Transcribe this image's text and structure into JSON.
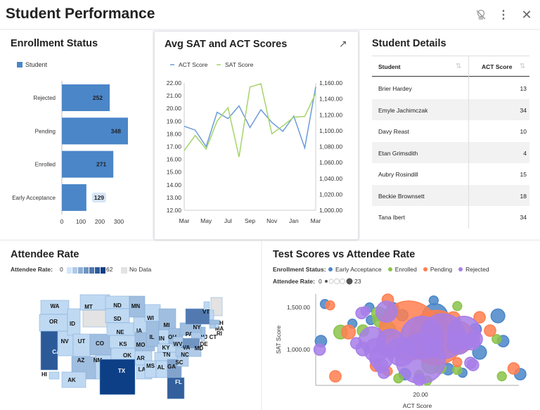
{
  "header": {
    "title": "Student Performance",
    "icons": [
      "no-filter-icon",
      "more-vert-icon",
      "close-icon"
    ]
  },
  "enrollment": {
    "title": "Enrollment Status",
    "legend": "Student",
    "color": "#4a86c8",
    "chart_data": {
      "type": "bar",
      "orientation": "horizontal",
      "categories": [
        "Rejected",
        "Pending",
        "Enrolled",
        "Early Acceptance"
      ],
      "series": [
        {
          "name": "Student",
          "values": [
            252,
            348,
            271,
            129
          ]
        }
      ],
      "xticks": [
        "0",
        "100",
        "200",
        "300"
      ],
      "xlim": [
        0,
        350
      ]
    }
  },
  "sat_act": {
    "title": "Avg SAT and ACT Scores",
    "expand_icon": "expand-arrow-icon",
    "chart_data": {
      "type": "line",
      "x": [
        "Mar",
        "Apr",
        "May",
        "Jun",
        "Jul",
        "Aug",
        "Sep",
        "Oct",
        "Nov",
        "Dec",
        "Jan",
        "Feb",
        "Mar"
      ],
      "xticks": [
        "Mar",
        "May",
        "Jul",
        "Sep",
        "Nov",
        "Jan",
        "Mar"
      ],
      "series": [
        {
          "name": "ACT Score",
          "axis": "left",
          "color": "#6b9bd8",
          "values": [
            18.6,
            18.3,
            17.0,
            19.7,
            19.2,
            20.2,
            18.5,
            19.9,
            18.9,
            18.2,
            19.4,
            16.9,
            21.7
          ]
        },
        {
          "name": "SAT Score",
          "axis": "right",
          "color": "#a6d46b",
          "values": [
            1075,
            1094,
            1077,
            1112,
            1129,
            1067,
            1155,
            1159,
            1096,
            1106,
            1117,
            1118,
            1147
          ]
        }
      ],
      "ylim_left": [
        12,
        22
      ],
      "yticks_left": [
        "22.00",
        "21.00",
        "20.00",
        "19.00",
        "18.00",
        "17.00",
        "16.00",
        "15.00",
        "14.00",
        "13.00",
        "12.00"
      ],
      "ylim_right": [
        1000,
        1160
      ],
      "yticks_right": [
        "1,160.00",
        "1,140.00",
        "1,120.00",
        "1,100.00",
        "1,080.00",
        "1,060.00",
        "1,040.00",
        "1,020.00",
        "1,000.00"
      ],
      "legend": "top-left"
    }
  },
  "details": {
    "title": "Student Details",
    "columns": [
      "Student",
      "ACT Score"
    ],
    "rows": [
      [
        "Brier Hardey",
        "13"
      ],
      [
        "Emyle Jachimczak",
        "34"
      ],
      [
        "Davy Reast",
        "10"
      ],
      [
        "Etan Grimsdith",
        "4"
      ],
      [
        "Aubry Rosindill",
        "15"
      ],
      [
        "Beckie Brownsett",
        "18"
      ],
      [
        "Tana Ibert",
        "34"
      ]
    ]
  },
  "attendee": {
    "title": "Attendee Rate",
    "legend_label": "Attendee Rate:",
    "min": "0",
    "max": "62",
    "nodata": "No Data",
    "color_low": "#cfe6fb",
    "color_high": "#0d3f86",
    "nodata_color": "#e3e3e3",
    "states": {
      "WA": 5,
      "OR": 5,
      "CA": 52,
      "NV": 5,
      "ID": 5,
      "MT": 5,
      "WY": null,
      "UT": 5,
      "CO": 15,
      "AZ": 15,
      "NM": 5,
      "ND": 5,
      "SD": 5,
      "NE": 5,
      "KS": 5,
      "OK": 5,
      "TX": 62,
      "MN": 15,
      "IA": 5,
      "MO": 15,
      "AR": 5,
      "LA": 5,
      "WI": 5,
      "IL": 15,
      "MS": 5,
      "MI": 15,
      "IN": 5,
      "OH": 15,
      "KY": 5,
      "TN": 5,
      "AL": 5,
      "GA": 25,
      "FL": 50,
      "SC": 8,
      "NC": 10,
      "VA": 30,
      "WV": 10,
      "PA": 15,
      "NY": 40,
      "VT": 5,
      "ME": null,
      "NH": 5,
      "MA": 15,
      "RI": 5,
      "CT": 10,
      "NJ": 15,
      "DE": 5,
      "MD": 10,
      "AK": 5,
      "HI": 5
    }
  },
  "scatter": {
    "title": "Test Scores vs Attendee Rate",
    "status_label": "Enrollment Status:",
    "rate_label": "Attendee Rate:",
    "rate_min": "0",
    "rate_max": "23",
    "chart_data": {
      "type": "scatter",
      "xlabel": "ACT Score",
      "ylabel": "SAT Score",
      "xticks": [
        "20.00"
      ],
      "yticks": [
        "1,500.00",
        "1,000.00"
      ],
      "xlim": [
        12,
        27.5
      ],
      "ylim": [
        575,
        1660
      ],
      "series": [
        {
          "name": "Early Acceptance",
          "color": "#4a86c8",
          "points": [
            [
              12.7,
              1541,
              2
            ],
            [
              12.4,
              1100,
              3
            ],
            [
              16.1,
              1500,
              2
            ],
            [
              16.2,
              1350,
              2
            ],
            [
              17.9,
              1490,
              3
            ],
            [
              18.6,
              1408,
              3
            ],
            [
              21.0,
              1583,
              2
            ],
            [
              21.1,
              1392,
              9
            ],
            [
              21.7,
              1292,
              4
            ],
            [
              22.3,
              1267,
              4
            ],
            [
              24.2,
              1242,
              3
            ],
            [
              25.9,
              1400,
              4
            ],
            [
              26.3,
              1100,
              3
            ],
            [
              24.5,
              967,
              4
            ],
            [
              22.1,
              767,
              3
            ],
            [
              23.2,
              725,
              2
            ],
            [
              18.8,
              708,
              3
            ],
            [
              27.6,
              708,
              3
            ],
            [
              20.7,
              1058,
              10
            ],
            [
              14.8,
              1308,
              2
            ]
          ]
        },
        {
          "name": "Enrolled",
          "color": "#8bc34a",
          "points": [
            [
              13.9,
              1208,
              4
            ],
            [
              15.6,
              1225,
              3
            ],
            [
              16.8,
              1425,
              4
            ],
            [
              16.9,
              1350,
              4
            ],
            [
              17.5,
              1233,
              5
            ],
            [
              22.8,
              1516,
              2
            ],
            [
              25.8,
              1125,
              2
            ],
            [
              26.2,
              683,
              2
            ],
            [
              18.3,
              658,
              2
            ],
            [
              19.9,
              700,
              2
            ],
            [
              20.5,
              633,
              2
            ],
            [
              20.8,
              825,
              6
            ],
            [
              21.5,
              783,
              3
            ],
            [
              22.8,
              758,
              2
            ],
            [
              22.9,
              1058,
              4
            ],
            [
              17.6,
              1425,
              3
            ]
          ]
        },
        {
          "name": "Pending",
          "color": "#ff7f50",
          "points": [
            [
              17.5,
              1591,
              3
            ],
            [
              13.1,
              1525,
              2
            ],
            [
              14.5,
              1208,
              4
            ],
            [
              13.5,
              683,
              3
            ],
            [
              16.6,
              808,
              3
            ],
            [
              17.5,
              742,
              2
            ],
            [
              19.1,
              1225,
              23
            ],
            [
              21.2,
              1142,
              21
            ],
            [
              22.5,
              1367,
              4
            ],
            [
              22.8,
              850,
              2
            ],
            [
              24.5,
              1383,
              3
            ],
            [
              25.3,
              1225,
              3
            ],
            [
              27.1,
              775,
              3
            ],
            [
              22.8,
              1142,
              12
            ]
          ]
        },
        {
          "name": "Rejected",
          "color": "#a77ee8",
          "points": [
            [
              12.3,
              1000,
              3
            ],
            [
              15.5,
              1433,
              3
            ],
            [
              15.8,
              1458,
              2
            ],
            [
              17.4,
              1450,
              7
            ],
            [
              15.1,
              1075,
              3
            ],
            [
              15.6,
              1008,
              4
            ],
            [
              16.3,
              1117,
              9
            ],
            [
              16.6,
              992,
              8
            ],
            [
              17.0,
              900,
              8
            ],
            [
              17.0,
              808,
              4
            ],
            [
              17.2,
              725,
              3
            ],
            [
              20.0,
              892,
              19
            ],
            [
              20.1,
              1142,
              16
            ],
            [
              21.7,
              1158,
              17
            ],
            [
              23.3,
              1200,
              12
            ],
            [
              22.9,
              1083,
              8
            ],
            [
              23.9,
              1092,
              5
            ],
            [
              24.1,
              1125,
              5
            ],
            [
              23.8,
              842,
              3
            ],
            [
              24.0,
              817,
              3
            ],
            [
              19.9,
              642,
              3
            ],
            [
              18.5,
              975,
              10
            ],
            [
              17.7,
              1075,
              10
            ]
          ]
        }
      ]
    }
  }
}
